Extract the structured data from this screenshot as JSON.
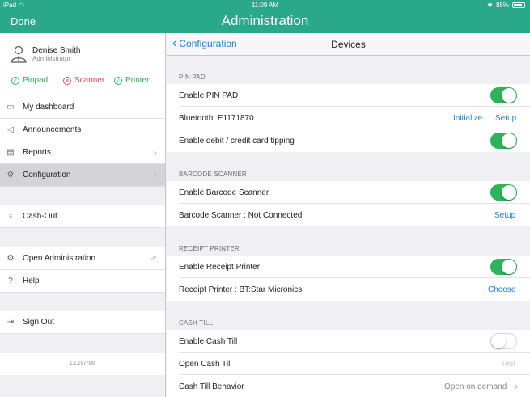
{
  "status_bar": {
    "device": "iPad",
    "time": "11:09 AM",
    "battery": "85%",
    "battery_level": 0.85
  },
  "header": {
    "done_label": "Done",
    "title": "Administration"
  },
  "sidebar": {
    "user": {
      "name": "Denise Smith",
      "role": "Administrator"
    },
    "devices": [
      {
        "label": "Pinpad",
        "status": "ok"
      },
      {
        "label": "Scanner",
        "status": "error"
      },
      {
        "label": "Printer",
        "status": "ok"
      }
    ],
    "items": [
      {
        "label": "My dashboard"
      },
      {
        "label": "Announcements"
      },
      {
        "label": "Reports"
      },
      {
        "label": "Configuration"
      },
      {
        "label": "Cash-Out"
      },
      {
        "label": "Open Administration"
      },
      {
        "label": "Help"
      },
      {
        "label": "Sign Out"
      }
    ],
    "version": "1.1.19779M"
  },
  "main": {
    "back_label": "Configuration",
    "title": "Devices",
    "sections": {
      "pin_pad": {
        "header": "PIN PAD",
        "enable_label": "Enable PIN PAD",
        "enable_on": true,
        "bluetooth_label": "Bluetooth: E1171870",
        "initialize_label": "Initialize",
        "setup_label": "Setup",
        "tipping_label": "Enable debit / credit card tipping",
        "tipping_on": true
      },
      "barcode": {
        "header": "BARCODE SCANNER",
        "enable_label": "Enable Barcode Scanner",
        "enable_on": true,
        "status_label": "Barcode Scanner : Not Connected",
        "setup_label": "Setup"
      },
      "receipt": {
        "header": "RECEIPT PRINTER",
        "enable_label": "Enable Receipt Printer",
        "enable_on": true,
        "printer_label": "Receipt Printer : BT:Star Micronics",
        "choose_label": "Choose"
      },
      "cash_till": {
        "header": "CASH TILL",
        "enable_label": "Enable Cash Till",
        "enable_on": false,
        "open_label": "Open Cash Till",
        "test_label": "Test",
        "behavior_label": "Cash Till Behavior",
        "behavior_value": "Open on demand"
      }
    }
  },
  "colors": {
    "accent": "#2aa98a",
    "link": "#1a82d2",
    "toggle_on": "#2db35a",
    "error": "#e2504c"
  }
}
